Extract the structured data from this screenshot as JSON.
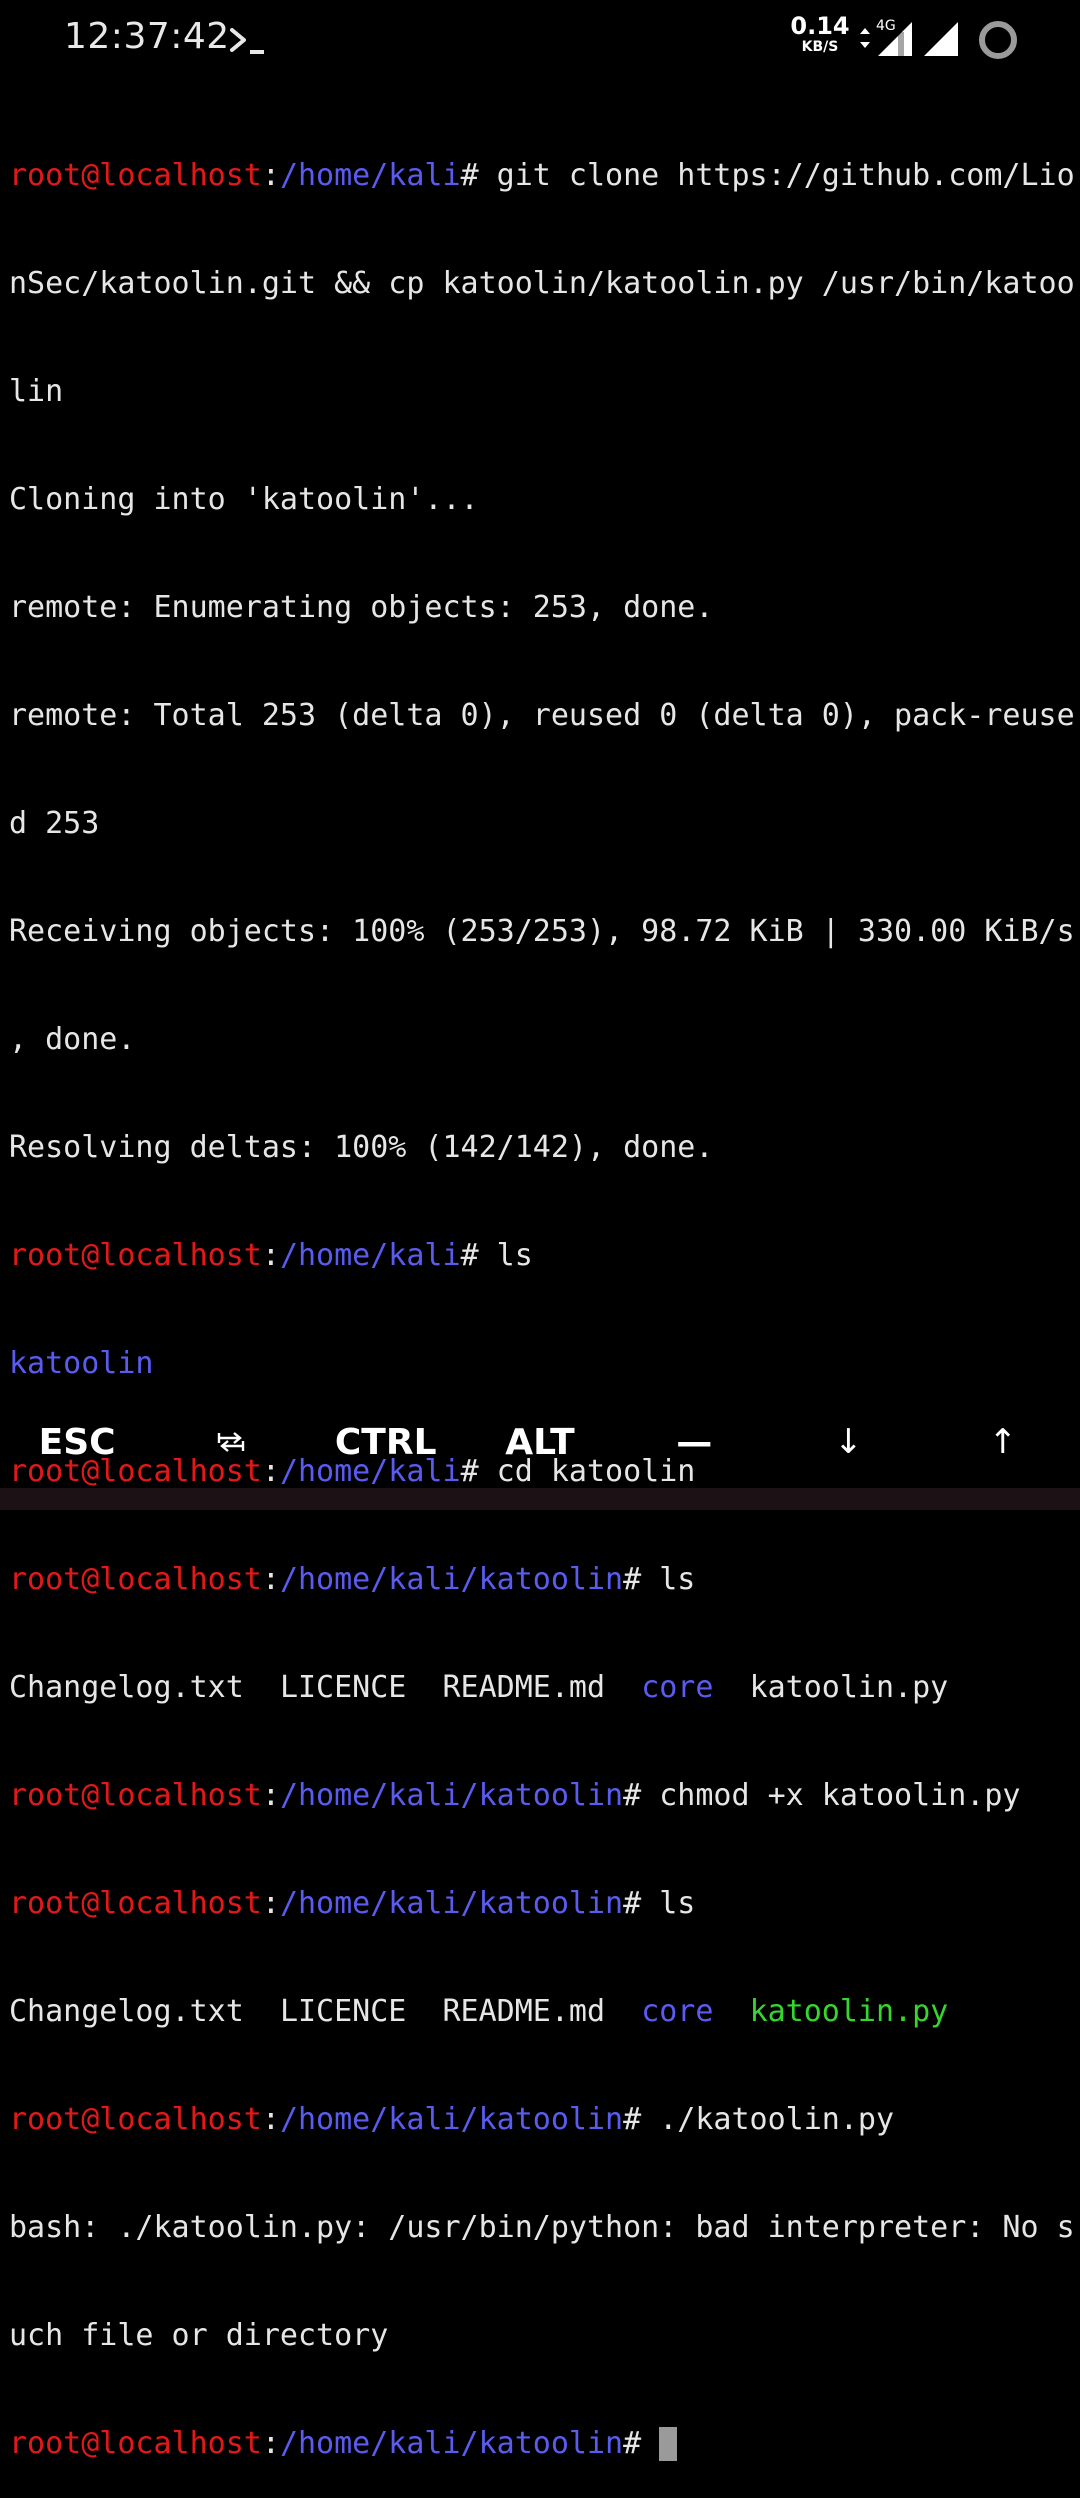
{
  "status_bar": {
    "time": "12:37:42",
    "net_speed_value": "0.14",
    "net_speed_unit": "KB/S",
    "network_type": "4G"
  },
  "colors": {
    "background": "#000000",
    "text": "#e6e6e6",
    "prompt_user": "#e31919",
    "prompt_path": "#5a5cf0",
    "directory": "#5a5cf0",
    "executable": "#36d62f",
    "cursor": "#9a9a9a"
  },
  "terminal": {
    "prompt_user": "root@localhost",
    "path_kali": "/home/kali",
    "path_katoolin": "/home/kali/katoolin",
    "cmd_1_part1": "# git clone https://github.com/Lio",
    "cmd_1_part2": "nSec/katoolin.git && cp katoolin/katoolin.py /usr/bin/katoo",
    "cmd_1_part3": "lin",
    "out_1": "Cloning into 'katoolin'...",
    "out_2": "remote: Enumerating objects: 253, done.",
    "out_3a": "remote: Total 253 (delta 0), reused 0 (delta 0), pack-reuse",
    "out_3b": "d 253",
    "out_4a": "Receiving objects: 100% (253/253), 98.72 KiB | 330.00 KiB/s",
    "out_4b": ", done.",
    "out_5": "Resolving deltas: 100% (142/142), done.",
    "cmd_2": "# ls",
    "ls_1": "katoolin",
    "cmd_3": "# cd katoolin",
    "cmd_4": "# ls",
    "files": {
      "changelog": "Changelog.txt",
      "licence": "LICENCE",
      "readme": "README.md",
      "core": "core",
      "katoolin_py": "katoolin.py"
    },
    "cmd_5": "# chmod +x katoolin.py",
    "cmd_6": "# ls",
    "cmd_7": "# ./katoolin.py",
    "err_a": "bash: ./katoolin.py: /usr/bin/python: bad interpreter: No s",
    "err_b": "uch file or directory",
    "cmd_8": "# "
  },
  "extra_keys": {
    "esc": "ESC",
    "tab": "⭾",
    "ctrl": "CTRL",
    "alt": "ALT",
    "dash": "—",
    "down": "↓",
    "up": "↑"
  }
}
